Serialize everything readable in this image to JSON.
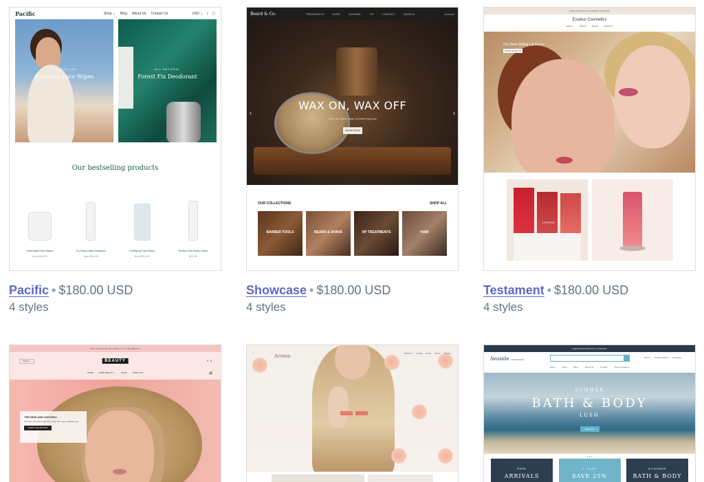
{
  "themes": [
    {
      "name": "Pacific",
      "price": "$180.00 USD",
      "styles": "4 styles"
    },
    {
      "name": "Showcase",
      "price": "$180.00 USD",
      "styles": "4 styles"
    },
    {
      "name": "Testament",
      "price": "$180.00 USD",
      "styles": "4 styles"
    }
  ],
  "separator": "•",
  "pacific": {
    "logo": "Pacific",
    "nav": [
      "Shop ⌄",
      "Blog",
      "About Us",
      "Contact Us"
    ],
    "currency": "USD ⌄",
    "hero_a": {
      "kicker": "BESTSELLING",
      "title": "Essential Face Wipes"
    },
    "hero_b": {
      "kicker": "ALL NATURAL",
      "title": "Forest Fix Deodorant"
    },
    "section_title": "Our bestselling products",
    "products": [
      {
        "name": "Essential Face Wipes",
        "price": "from $18.00"
      },
      {
        "name": "Go Easy Daily Shampoo",
        "price": "from $12.00"
      },
      {
        "name": "Fortifying Face Balm",
        "price": "from $14.00"
      },
      {
        "name": "Perfect Zen Body Lotion",
        "price": "$21.99"
      }
    ]
  },
  "showcase": {
    "logo": "Beard & Co.",
    "nav": [
      "TREATMENTS",
      "SHOP",
      "JOURNAL",
      "TIP",
      "CONTACT",
      "SEARCH"
    ],
    "account": "Account",
    "headline": "WAX ON, WAX OFF",
    "sub": "Shop our latest range of barbering tools",
    "cta": "SHOP NOW",
    "collections_title": "OUR COLLECTIONS",
    "collections_link": "SHOP ALL",
    "tiles": [
      "BARBER TOOLS",
      "BEARD & SHAVE",
      "HP TREATMENTS",
      "HAIR"
    ]
  },
  "testament": {
    "announcement": "FREE SHIPPING ON ORDERS OVER $100",
    "brand": "Exodus Cosmetics",
    "nav": [
      "SHOP ⌄",
      "ABOUT",
      "BLOG",
      "CONTACT"
    ],
    "hero_caption": "Our Best-Selling Lip Duo's",
    "hero_button": "SHOP LIP DUOS",
    "lip_label": "LIPSTICK"
  },
  "beauty": {
    "announcement": "20% off all skincare this weekend - Use code BEAUTY",
    "logo": "BEAUTY",
    "currency": "CAD $ ⌄",
    "nav": [
      "HOME",
      "SHOP BEAUTY ⌄",
      "BLOG",
      "ABOUT US"
    ],
    "box_title": "THE NEW AND NATURAL",
    "box_text": "The best, all-natural skincare range for a new, healthier you.",
    "box_button": "SHOP COLLECTION"
  },
  "aroma": {
    "logo": "Aroma",
    "nav": [
      "BEAUTY",
      "HOME",
      "BATH",
      "BLOG",
      "MORE ⌄"
    ]
  },
  "seaside": {
    "top_bar": "Featured announcement or promotion",
    "logo": "Seaside",
    "logo_sub": "Personal Care",
    "account": [
      "Sign in",
      "Create account",
      "Checkout"
    ],
    "nav": [
      "Home",
      "Shop",
      "Blog",
      "About Us",
      "Contact",
      "Theme Features"
    ],
    "hero_kicker": "SUMMER",
    "hero_title": "BATH & BODY",
    "hero_sub": "LUSH",
    "hero_button": "Shop Now",
    "dots": "• • •",
    "tiles": [
      {
        "kicker": "NEW",
        "title": "ARRIVALS",
        "color": "#2d3e50"
      },
      {
        "kicker": "3 DAYS",
        "title": "SAVE 25%",
        "color": "#6fb4c9"
      },
      {
        "kicker": "SUMMER",
        "title": "BATH & BODY",
        "color": "#2d3e50"
      }
    ]
  }
}
